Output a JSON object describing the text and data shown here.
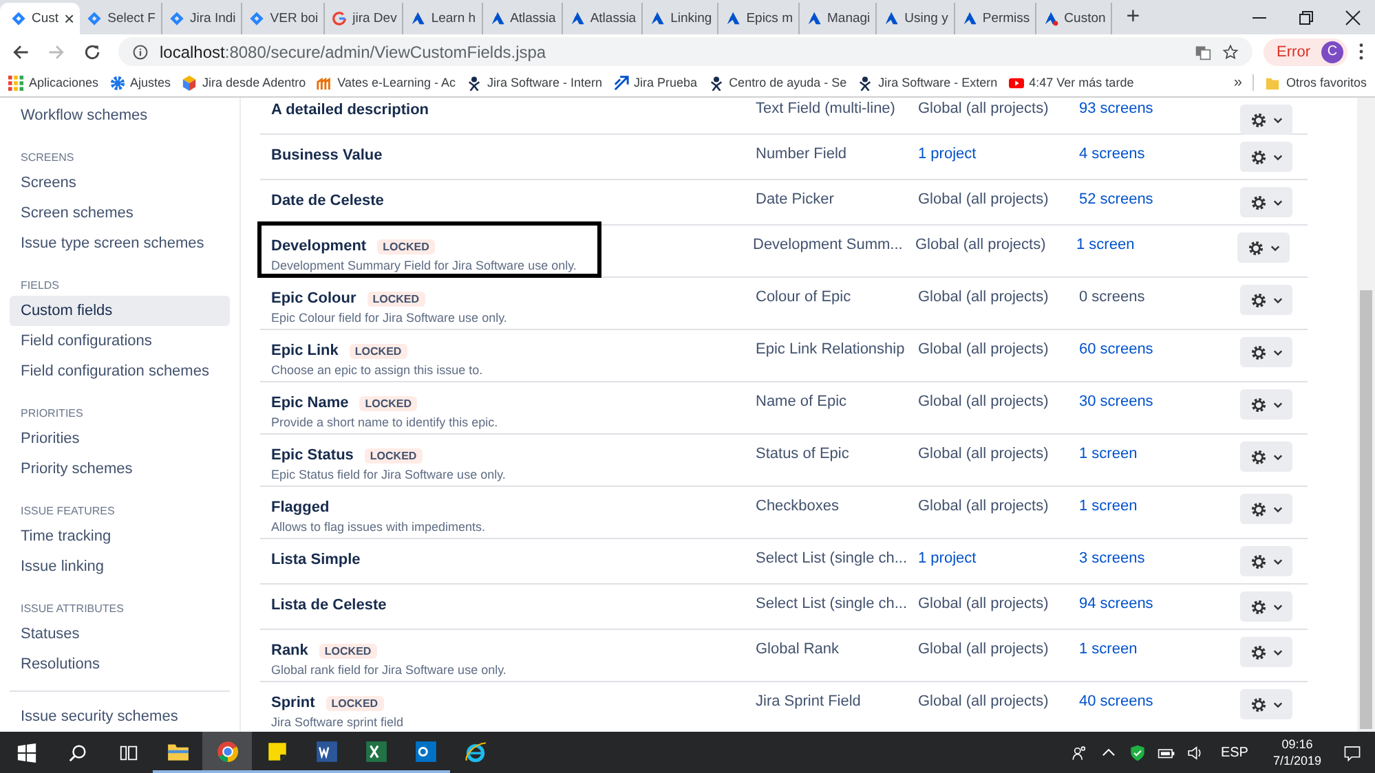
{
  "browser": {
    "tabs": [
      {
        "title": "Cust",
        "kind": "jira",
        "selected": true,
        "close": "×"
      },
      {
        "title": "Select F",
        "kind": "jira",
        "selected": false
      },
      {
        "title": "Jira Indi",
        "kind": "jira",
        "selected": false
      },
      {
        "title": "VER boi",
        "kind": "jira",
        "selected": false
      },
      {
        "title": "jira Dev",
        "kind": "google",
        "selected": false
      },
      {
        "title": "Learn h",
        "kind": "atlassian",
        "selected": false
      },
      {
        "title": "Atlassia",
        "kind": "atlassian",
        "selected": false
      },
      {
        "title": "Atlassia",
        "kind": "atlassian",
        "selected": false
      },
      {
        "title": "Linking",
        "kind": "atlassian",
        "selected": false
      },
      {
        "title": "Epics m",
        "kind": "atlassian",
        "selected": false
      },
      {
        "title": "Managi",
        "kind": "atlassian",
        "selected": false
      },
      {
        "title": "Using y",
        "kind": "atlassian",
        "selected": false
      },
      {
        "title": "Permiss",
        "kind": "atlassian",
        "selected": false
      },
      {
        "title": "Custon",
        "kind": "alert",
        "selected": false
      }
    ],
    "new_tab": "+",
    "address": {
      "host": "localhost",
      "rest": ":8080/secure/admin/ViewCustomFields.jspa"
    },
    "profile": {
      "status": "Error",
      "initial": "C"
    },
    "bookmarks": [
      {
        "label": "Aplicaciones",
        "kind": "apps"
      },
      {
        "label": "Ajustes",
        "kind": "gear"
      },
      {
        "label": "Jira desde Adentro",
        "kind": "cube"
      },
      {
        "label": "Vates e-Learning - Ac",
        "kind": "vates"
      },
      {
        "label": "Jira Software - Intern",
        "kind": "person"
      },
      {
        "label": "Jira Prueba",
        "kind": "arrows"
      },
      {
        "label": "Centro de ayuda - Se",
        "kind": "person"
      },
      {
        "label": "Jira Software - Extern",
        "kind": "person"
      },
      {
        "label": "4:47 Ver más tarde",
        "kind": "video"
      }
    ],
    "bookmarks_more": "»",
    "other_bookmarks": "Otros favoritos"
  },
  "sidebar": {
    "top_item": "Workflow schemes",
    "sections": [
      {
        "heading": "SCREENS",
        "items": [
          {
            "label": "Screens",
            "selected": false
          },
          {
            "label": "Screen schemes",
            "selected": false
          },
          {
            "label": "Issue type screen schemes",
            "selected": false
          }
        ]
      },
      {
        "heading": "FIELDS",
        "items": [
          {
            "label": "Custom fields",
            "selected": true
          },
          {
            "label": "Field configurations",
            "selected": false
          },
          {
            "label": "Field configuration schemes",
            "selected": false
          }
        ]
      },
      {
        "heading": "PRIORITIES",
        "items": [
          {
            "label": "Priorities",
            "selected": false
          },
          {
            "label": "Priority schemes",
            "selected": false
          }
        ]
      },
      {
        "heading": "ISSUE FEATURES",
        "items": [
          {
            "label": "Time tracking",
            "selected": false
          },
          {
            "label": "Issue linking",
            "selected": false
          }
        ]
      },
      {
        "heading": "ISSUE ATTRIBUTES",
        "items": [
          {
            "label": "Statuses",
            "selected": false
          },
          {
            "label": "Resolutions",
            "selected": false
          }
        ]
      }
    ],
    "bottom_item": "Issue security schemes"
  },
  "table": {
    "rows": [
      {
        "name": "A detailed description",
        "type": "Text Field (multi-line)",
        "context": "Global (all projects)",
        "context_link": false,
        "screens": "93 screens",
        "screens_link": true,
        "highlighted": false
      },
      {
        "name": "Business Value",
        "type": "Number Field",
        "context": "1 project",
        "context_link": true,
        "screens": "4 screens",
        "screens_link": true,
        "highlighted": false
      },
      {
        "name": "Date de Celeste",
        "type": "Date Picker",
        "context": "Global (all projects)",
        "context_link": false,
        "screens": "52 screens",
        "screens_link": true,
        "highlighted": false
      },
      {
        "name": "Development",
        "badge": "LOCKED",
        "description": "Development Summary Field for Jira Software use only.",
        "type": "Development Summ...",
        "context": "Global (all projects)",
        "context_link": false,
        "screens": "1 screen",
        "screens_link": true,
        "highlighted": true
      },
      {
        "name": "Epic Colour",
        "badge": "LOCKED",
        "description": "Epic Colour field for Jira Software use only.",
        "type": "Colour of Epic",
        "context": "Global (all projects)",
        "context_link": false,
        "screens": "0 screens",
        "screens_link": false,
        "highlighted": false
      },
      {
        "name": "Epic Link",
        "badge": "LOCKED",
        "description": "Choose an epic to assign this issue to.",
        "type": "Epic Link Relationship",
        "context": "Global (all projects)",
        "context_link": false,
        "screens": "60 screens",
        "screens_link": true,
        "highlighted": false
      },
      {
        "name": "Epic Name",
        "badge": "LOCKED",
        "description": "Provide a short name to identify this epic.",
        "type": "Name of Epic",
        "context": "Global (all projects)",
        "context_link": false,
        "screens": "30 screens",
        "screens_link": true,
        "highlighted": false
      },
      {
        "name": "Epic Status",
        "badge": "LOCKED",
        "description": "Epic Status field for Jira Software use only.",
        "type": "Status of Epic",
        "context": "Global (all projects)",
        "context_link": false,
        "screens": "1 screen",
        "screens_link": true,
        "highlighted": false
      },
      {
        "name": "Flagged",
        "description": "Allows to flag issues with impediments.",
        "type": "Checkboxes",
        "context": "Global (all projects)",
        "context_link": false,
        "screens": "1 screen",
        "screens_link": true,
        "highlighted": false
      },
      {
        "name": "Lista Simple",
        "type": "Select List (single ch...",
        "context": "1 project",
        "context_link": true,
        "screens": "3 screens",
        "screens_link": true,
        "highlighted": false
      },
      {
        "name": "Lista de Celeste",
        "type": "Select List (single ch...",
        "context": "Global (all projects)",
        "context_link": false,
        "screens": "94 screens",
        "screens_link": true,
        "highlighted": false
      },
      {
        "name": "Rank",
        "badge": "LOCKED",
        "description": "Global rank field for Jira Software use only.",
        "type": "Global Rank",
        "context": "Global (all projects)",
        "context_link": false,
        "screens": "1 screen",
        "screens_link": true,
        "highlighted": false
      },
      {
        "name": "Sprint",
        "badge": "LOCKED",
        "description": "Jira Software sprint field",
        "type": "Jira Sprint Field",
        "context": "Global (all projects)",
        "context_link": false,
        "screens": "40 screens",
        "screens_link": true,
        "highlighted": false
      }
    ]
  },
  "taskbar": {
    "apps": [
      {
        "kind": "explorer",
        "active": false,
        "running": true
      },
      {
        "kind": "chrome",
        "active": true,
        "running": true
      },
      {
        "kind": "notes",
        "active": false,
        "running": true
      },
      {
        "kind": "word",
        "active": false,
        "running": true
      },
      {
        "kind": "excel",
        "active": false,
        "running": true
      },
      {
        "kind": "outlook",
        "active": false,
        "running": true
      },
      {
        "kind": "ie",
        "active": false,
        "running": false
      }
    ],
    "language": "ESP",
    "time": "09:16",
    "date": "7/1/2019"
  }
}
